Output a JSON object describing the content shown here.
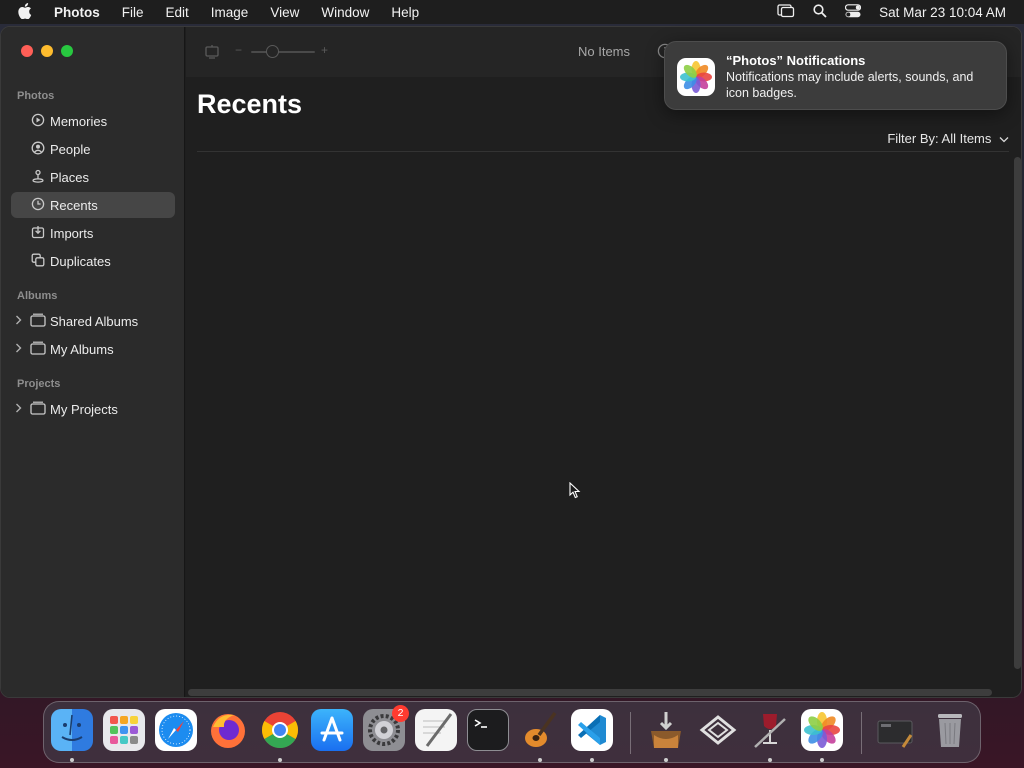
{
  "menubar": {
    "app_name": "Photos",
    "menus": [
      "File",
      "Edit",
      "Image",
      "View",
      "Window",
      "Help"
    ],
    "clock": "Sat Mar 23  10:04 AM"
  },
  "sidebar": {
    "section_photos": "Photos",
    "photos_items": [
      {
        "label": "Memories",
        "icon": "memories-icon"
      },
      {
        "label": "People",
        "icon": "people-icon"
      },
      {
        "label": "Places",
        "icon": "places-icon"
      },
      {
        "label": "Recents",
        "icon": "clock-icon",
        "selected": true
      },
      {
        "label": "Imports",
        "icon": "imports-icon"
      },
      {
        "label": "Duplicates",
        "icon": "duplicates-icon"
      }
    ],
    "section_albums": "Albums",
    "album_items": [
      {
        "label": "Shared Albums",
        "icon": "shared-albums-icon"
      },
      {
        "label": "My Albums",
        "icon": "folder-icon"
      }
    ],
    "section_projects": "Projects",
    "project_items": [
      {
        "label": "My Projects",
        "icon": "folder-icon"
      }
    ]
  },
  "toolbar": {
    "zoom_minus": "−",
    "zoom_plus": "+",
    "status": "No Items"
  },
  "main": {
    "title": "Recents",
    "filter_prefix": "Filter By: ",
    "filter_value": "All Items"
  },
  "notification": {
    "title": "“Photos” Notifications",
    "body": "Notifications may include alerts, sounds, and icon badges."
  },
  "dock": {
    "badge": "2",
    "apps": [
      "Finder",
      "Launchpad",
      "Safari",
      "Firefox",
      "Chrome",
      "App Store",
      "System Settings",
      "TextEdit",
      "Terminal",
      "GarageBand",
      "VS Code",
      "Installer",
      "Xcode",
      "Wine",
      "Photos",
      "Screenshot",
      "Trash"
    ]
  },
  "colors": {
    "selection": "#464646",
    "close": "#ff5f57",
    "minimize": "#febc2e",
    "zoom": "#28c840"
  }
}
